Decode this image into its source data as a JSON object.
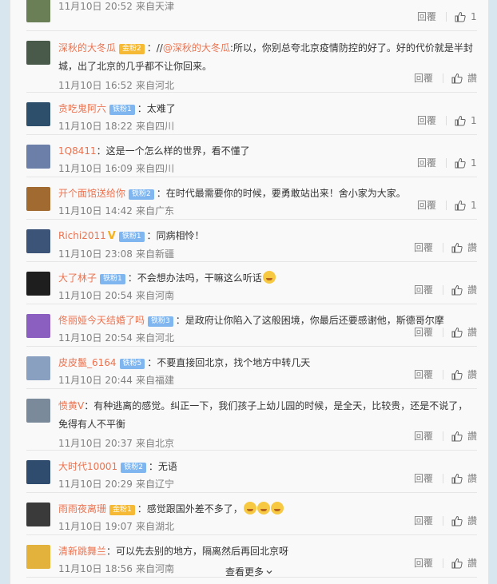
{
  "reply_label": "回覆",
  "load_more": "查看更多",
  "comments": [
    {
      "user": "",
      "badge": "",
      "badge_type": "",
      "text": "",
      "time": "11月10日 20:52",
      "source": "来自天津",
      "likes": "1",
      "avatar_color": "#6a7f55",
      "partial": true
    },
    {
      "user": "深秋的大冬瓜",
      "badge": "金粉2",
      "badge_type": "gold",
      "verified": false,
      "text_prefix": "：//",
      "mention": "@深秋的大冬瓜",
      "text": ":所以，你别总夸北京疫情防控的好了。好的代价就是半封城，出了北京的几乎都不让你回来。",
      "time": "11月10日 16:52",
      "source": "来自河北",
      "likes": "讚",
      "avatar_color": "#4a5a4a",
      "tall": true
    },
    {
      "user": "贪吃鬼阿六",
      "badge": "铁粉1",
      "badge_type": "blue",
      "text": "：太难了",
      "time": "11月10日 18:22",
      "source": "来自四川",
      "likes": "1",
      "avatar_color": "#2d4f6c"
    },
    {
      "user": "1Q8411",
      "badge": "",
      "badge_type": "",
      "text": "：这是一个怎么样的世界，看不懂了",
      "time": "11月10日 16:09",
      "source": "来自四川",
      "likes": "1",
      "avatar_color": "#6c7fa8"
    },
    {
      "user": "开个面馆送给你",
      "badge": "铁粉2",
      "badge_type": "blue",
      "text": "：在时代最需要你的时候，要勇敢站出来！舍小家为大家。",
      "time": "11月10日 14:42",
      "source": "来自广东",
      "likes": "1",
      "avatar_color": "#a06a30"
    },
    {
      "user": "Richi2011",
      "badge": "铁粉1",
      "badge_type": "blue",
      "verified": true,
      "text": "：同病相怜！",
      "time": "11月10日 23:08",
      "source": "来自新疆",
      "likes": "讚",
      "avatar_color": "#3b5478"
    },
    {
      "user": "大了林子",
      "badge": "铁粉1",
      "badge_type": "blue",
      "text": "：不会想办法吗，干嘛这么听话",
      "emoji_count": 1,
      "time": "11月10日 20:54",
      "source": "来自河南",
      "likes": "讚",
      "avatar_color": "#1e1e1e"
    },
    {
      "user": "佟丽娅今天结婚了吗",
      "badge": "铁粉3",
      "badge_type": "blue",
      "text": "：是政府让你陷入了这般困境，你最后还要感谢他，斯德哥尔摩",
      "time": "11月10日 20:54",
      "source": "来自河北",
      "likes": "讚",
      "avatar_color": "#8a5fc0"
    },
    {
      "user": "皮皮鬣_6164",
      "badge": "铁粉5",
      "badge_type": "blue",
      "text": "：不要直接回北京，找个地方中转几天",
      "time": "11月10日 20:44",
      "source": "来自福建",
      "likes": "讚",
      "avatar_color": "#8aa0c0"
    },
    {
      "user": "愤黄V",
      "badge": "",
      "badge_type": "",
      "text": "：有种逃离的感觉。纠正一下，我们孩子上幼儿园的时候，是全天，比较贵，还是不说了，免得有人不平衡",
      "time": "11月10日 20:37",
      "source": "来自北京",
      "likes": "讚",
      "avatar_color": "#7a8a9a",
      "tall": true
    },
    {
      "user": "大时代10001",
      "badge": "铁粉2",
      "badge_type": "blue",
      "text": "：无语",
      "time": "11月10日 20:29",
      "source": "来自辽宁",
      "likes": "讚",
      "avatar_color": "#2f4b6e"
    },
    {
      "user": "雨雨夜离珊",
      "badge": "金粉1",
      "badge_type": "gold",
      "text": "：感觉跟国外差不多了，",
      "emoji_count": 3,
      "time": "11月10日 19:07",
      "source": "来自湖北",
      "likes": "讚",
      "avatar_color": "#3a3a3a"
    },
    {
      "user": "清新跳舞兰",
      "badge": "",
      "badge_type": "",
      "text": "：可以先去别的地方，隔离然后再回北京呀",
      "time": "11月10日 18:56",
      "source": "来自河南",
      "likes": "讚",
      "avatar_color": "#e3b23c"
    }
  ]
}
